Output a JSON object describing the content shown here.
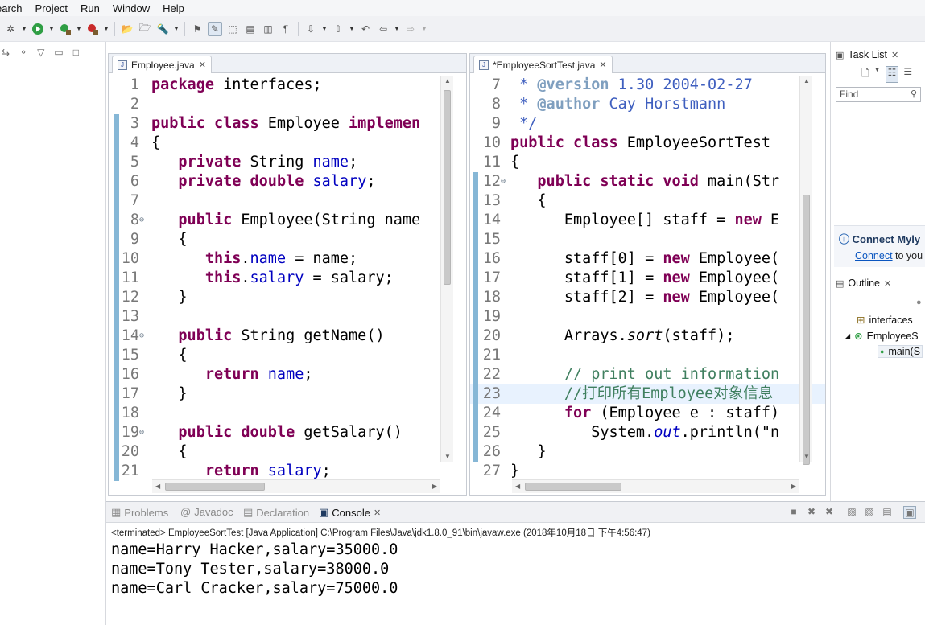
{
  "menu": [
    "earch",
    "Project",
    "Run",
    "Window",
    "Help"
  ],
  "left_editor": {
    "tab": "Employee.java",
    "lines": [
      {
        "n": "1",
        "mark": false,
        "fold": false,
        "html": "<span class=\"kw\">package</span> interfaces;"
      },
      {
        "n": "2",
        "mark": false,
        "fold": false,
        "html": ""
      },
      {
        "n": "3",
        "mark": true,
        "fold": false,
        "html": "<span class=\"kw\">public class</span> Employee <span class=\"kw\">implemen</span>"
      },
      {
        "n": "4",
        "mark": true,
        "fold": false,
        "html": "{"
      },
      {
        "n": "5",
        "mark": true,
        "fold": false,
        "html": "   <span class=\"kw\">private</span> String <span class=\"fld\">name</span>;"
      },
      {
        "n": "6",
        "mark": true,
        "fold": false,
        "html": "   <span class=\"kw\">private double</span> <span class=\"fld\">salary</span>;"
      },
      {
        "n": "7",
        "mark": true,
        "fold": false,
        "html": ""
      },
      {
        "n": "8",
        "mark": true,
        "fold": true,
        "html": "   <span class=\"kw\">public</span> Employee(String name"
      },
      {
        "n": "9",
        "mark": true,
        "fold": false,
        "html": "   {"
      },
      {
        "n": "10",
        "mark": true,
        "fold": false,
        "html": "      <span class=\"kw\">this</span>.<span class=\"fld\">name</span> = name;"
      },
      {
        "n": "11",
        "mark": true,
        "fold": false,
        "html": "      <span class=\"kw\">this</span>.<span class=\"fld\">salary</span> = salary;"
      },
      {
        "n": "12",
        "mark": true,
        "fold": false,
        "html": "   }"
      },
      {
        "n": "13",
        "mark": true,
        "fold": false,
        "html": ""
      },
      {
        "n": "14",
        "mark": true,
        "fold": true,
        "html": "   <span class=\"kw\">public</span> String getName()"
      },
      {
        "n": "15",
        "mark": true,
        "fold": false,
        "html": "   {"
      },
      {
        "n": "16",
        "mark": true,
        "fold": false,
        "html": "      <span class=\"kw\">return</span> <span class=\"fld\">name</span>;"
      },
      {
        "n": "17",
        "mark": true,
        "fold": false,
        "html": "   }"
      },
      {
        "n": "18",
        "mark": true,
        "fold": false,
        "html": ""
      },
      {
        "n": "19",
        "mark": true,
        "fold": true,
        "html": "   <span class=\"kw\">public double</span> getSalary()"
      },
      {
        "n": "20",
        "mark": true,
        "fold": false,
        "html": "   {"
      },
      {
        "n": "21",
        "mark": true,
        "fold": false,
        "html": "      <span class=\"kw\">return</span> <span class=\"fld\">salary</span>;"
      }
    ]
  },
  "right_editor": {
    "tab": "*EmployeeSortTest.java",
    "lines": [
      {
        "n": "7",
        "mark": false,
        "fold": false,
        "cur": false,
        "html": "<span class=\"jdoc\"> * </span><span class=\"tag\">@version</span><span class=\"jdoc\"> 1.30 2004-02-27</span>"
      },
      {
        "n": "8",
        "mark": false,
        "fold": false,
        "cur": false,
        "html": "<span class=\"jdoc\"> * </span><span class=\"tag\">@author</span><span class=\"jdoc\"> Cay Horstmann</span>"
      },
      {
        "n": "9",
        "mark": false,
        "fold": false,
        "cur": false,
        "html": "<span class=\"jdoc\"> */</span>"
      },
      {
        "n": "10",
        "mark": false,
        "fold": false,
        "cur": false,
        "html": "<span class=\"kw\">public class</span> EmployeeSortTest"
      },
      {
        "n": "11",
        "mark": false,
        "fold": false,
        "cur": false,
        "html": "{"
      },
      {
        "n": "12",
        "mark": true,
        "fold": true,
        "cur": false,
        "html": "   <span class=\"kw\">public static void</span> main(Str"
      },
      {
        "n": "13",
        "mark": true,
        "fold": false,
        "cur": false,
        "html": "   {"
      },
      {
        "n": "14",
        "mark": true,
        "fold": false,
        "cur": false,
        "html": "      Employee[] staff = <span class=\"kw\">new</span> E"
      },
      {
        "n": "15",
        "mark": true,
        "fold": false,
        "cur": false,
        "html": ""
      },
      {
        "n": "16",
        "mark": true,
        "fold": false,
        "cur": false,
        "html": "      staff[0] = <span class=\"kw\">new</span> Employee("
      },
      {
        "n": "17",
        "mark": true,
        "fold": false,
        "cur": false,
        "html": "      staff[1] = <span class=\"kw\">new</span> Employee("
      },
      {
        "n": "18",
        "mark": true,
        "fold": false,
        "cur": false,
        "html": "      staff[2] = <span class=\"kw\">new</span> Employee("
      },
      {
        "n": "19",
        "mark": true,
        "fold": false,
        "cur": false,
        "html": ""
      },
      {
        "n": "20",
        "mark": true,
        "fold": false,
        "cur": false,
        "html": "      Arrays.<span class=\"ital\">sort</span>(staff);"
      },
      {
        "n": "21",
        "mark": true,
        "fold": false,
        "cur": false,
        "html": ""
      },
      {
        "n": "22",
        "mark": true,
        "fold": false,
        "cur": false,
        "html": "      <span class=\"cmt\">// print out information</span>"
      },
      {
        "n": "23",
        "mark": true,
        "fold": false,
        "cur": true,
        "html": "      <span class=\"cmt\">//打印所有Employee对象信息</span>"
      },
      {
        "n": "24",
        "mark": true,
        "fold": false,
        "cur": false,
        "html": "      <span class=\"kw\">for</span> (Employee e : staff)"
      },
      {
        "n": "25",
        "mark": true,
        "fold": false,
        "cur": false,
        "html": "         System.<span class=\"stat\">out</span>.println(\"n"
      },
      {
        "n": "26",
        "mark": true,
        "fold": false,
        "cur": false,
        "html": "   }"
      },
      {
        "n": "27",
        "mark": false,
        "fold": false,
        "cur": false,
        "html": "}"
      }
    ]
  },
  "right_panel": {
    "task_list": "Task List",
    "find_placeholder": "Find",
    "connect_title": "Connect Myly",
    "connect_link": "Connect",
    "connect_rest": " to you",
    "outline": "Outline",
    "tree": [
      "interfaces",
      "EmployeeS",
      "main(S"
    ]
  },
  "console": {
    "tabs": {
      "problems": "Problems",
      "javadoc": "Javadoc",
      "declaration": "Declaration",
      "console": "Console"
    },
    "status": "<terminated> EmployeeSortTest [Java Application] C:\\Program Files\\Java\\jdk1.8.0_91\\bin\\javaw.exe (2018年10月18日 下午4:56:47)",
    "output": [
      "name=Harry Hacker,salary=35000.0",
      "name=Tony Tester,salary=38000.0",
      "name=Carl Cracker,salary=75000.0"
    ]
  }
}
